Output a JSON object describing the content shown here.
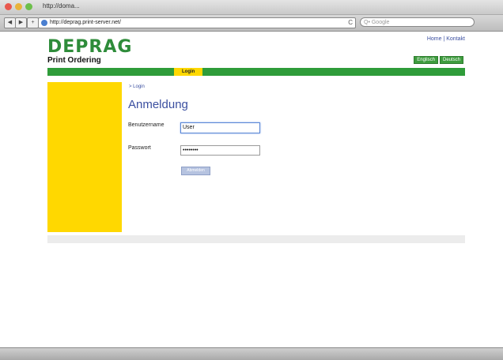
{
  "browser": {
    "title_url": "http://doma...",
    "url": "http://deprag.print-server.net/",
    "search_placeholder": "Google",
    "search_prefix": "Q•",
    "reload_glyph": "C",
    "back_glyph": "◀",
    "forward_glyph": "▶",
    "add_glyph": "+"
  },
  "header": {
    "brand": "DEPRAG",
    "subtitle": "Print Ordering",
    "links": [
      "Home",
      "Kontakt"
    ],
    "link_separator": "|",
    "languages": [
      "Englisch",
      "Deutsch"
    ]
  },
  "menu": {
    "active": "Login"
  },
  "content": {
    "breadcrumb": "> Login",
    "heading": "Anmeldung",
    "username_label": "Benutzername",
    "username_value": "User",
    "password_label": "Passwort",
    "password_value": "••••••••",
    "submit_label": "Abmelden"
  },
  "colors": {
    "brand_green": "#2e8c3a",
    "menu_green": "#2f9c3a",
    "accent_yellow": "#ffd800",
    "link_blue": "#3b4fa0"
  }
}
